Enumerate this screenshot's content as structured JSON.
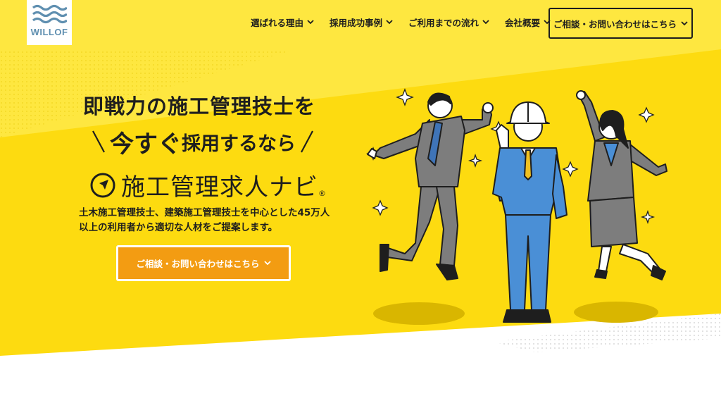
{
  "logo": {
    "text": "WILLOF"
  },
  "nav": {
    "items": [
      {
        "label": "選ばれる理由"
      },
      {
        "label": "採用成功事例"
      },
      {
        "label": "ご利用までの流れ"
      },
      {
        "label": "会社概要"
      }
    ],
    "cta_label": "ご相談・お問い合わせはこちら"
  },
  "hero": {
    "headline": "即戦力の施工管理技士を",
    "subline_big": "今すぐ",
    "subline_rest": "採用するなら",
    "brand_name": "施工管理求人ナビ",
    "brand_reg": "®",
    "description": "土木施工管理技士、建築施工管理技士を中心とした45万人以上の利用者から適切な人材をご提案します。",
    "cta_label": "ご相談・お問い合わせはこちら"
  },
  "colors": {
    "hero_yellow": "#fddb10",
    "hero_yellow_light": "#fee740",
    "cta_orange": "#f39c12",
    "text_dark": "#1e1e1e"
  }
}
